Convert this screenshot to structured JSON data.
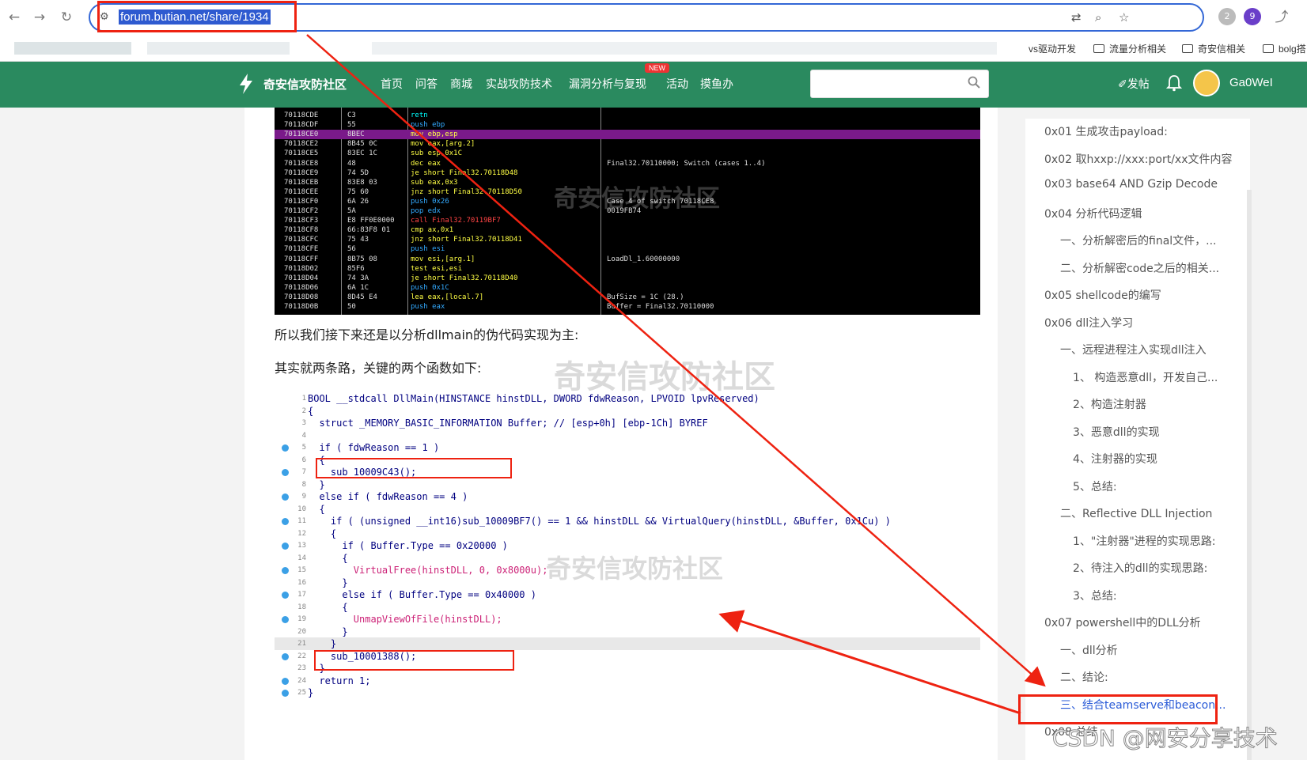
{
  "browser": {
    "url": "forum.butian.net/share/1934",
    "bookmarks": [
      "vs驱动开发",
      "流量分析相关",
      "奇安信相关",
      "bolg搭"
    ],
    "ext_badges": [
      "2",
      "9"
    ]
  },
  "site": {
    "logo": "奇安信攻防社区",
    "nav": [
      "首页",
      "问答",
      "商城",
      "实战攻防技术",
      "漏洞分析与复现",
      "活动",
      "摸鱼办"
    ],
    "new_badge": "NEW",
    "post_label": "✐发帖",
    "username": "Ga0WeI"
  },
  "disasm": {
    "rows": [
      {
        "addr": "70118CDE",
        "bytes": "C3",
        "ins": "retn",
        "comment": ""
      },
      {
        "addr": "70118CDF",
        "bytes": "55",
        "ins": "push ebp",
        "comment": ""
      },
      {
        "addr": "70118CE0",
        "bytes": "8BEC",
        "ins": "mov ebp,esp",
        "comment": ""
      },
      {
        "addr": "70118CE2",
        "bytes": "8B45 0C",
        "ins": "mov eax,[arg.2]",
        "comment": ""
      },
      {
        "addr": "70118CE5",
        "bytes": "83EC 1C",
        "ins": "sub esp,0x1C",
        "comment": ""
      },
      {
        "addr": "70118CE8",
        "bytes": "48",
        "ins": "dec eax",
        "comment": "Final32.70110000; Switch (cases 1..4)"
      },
      {
        "addr": "70118CE9",
        "bytes": "74 5D",
        "ins": "je short Final32.70118D48",
        "comment": ""
      },
      {
        "addr": "70118CEB",
        "bytes": "83E8 03",
        "ins": "sub eax,0x3",
        "comment": ""
      },
      {
        "addr": "70118CEE",
        "bytes": "75 60",
        "ins": "jnz short Final32.70118D50",
        "comment": ""
      },
      {
        "addr": "70118CF0",
        "bytes": "6A 26",
        "ins": "push 0x26",
        "comment": "Case 4 of switch 70118CE8"
      },
      {
        "addr": "70118CF2",
        "bytes": "5A",
        "ins": "pop edx",
        "comment": "0019FB74"
      },
      {
        "addr": "70118CF3",
        "bytes": "E8 FF0E0000",
        "ins": "call Final32.70119BF7",
        "comment": ""
      },
      {
        "addr": "70118CF8",
        "bytes": "66:83F8 01",
        "ins": "cmp ax,0x1",
        "comment": ""
      },
      {
        "addr": "70118CFC",
        "bytes": "75 43",
        "ins": "jnz short Final32.70118D41",
        "comment": ""
      },
      {
        "addr": "70118CFE",
        "bytes": "56",
        "ins": "push esi",
        "comment": ""
      },
      {
        "addr": "70118CFF",
        "bytes": "8B75 08",
        "ins": "mov esi,[arg.1]",
        "comment": "LoadDl_1.60000000"
      },
      {
        "addr": "70118D02",
        "bytes": "85F6",
        "ins": "test esi,esi",
        "comment": ""
      },
      {
        "addr": "70118D04",
        "bytes": "74 3A",
        "ins": "je short Final32.70118D40",
        "comment": ""
      },
      {
        "addr": "70118D06",
        "bytes": "6A 1C",
        "ins": "push 0x1C",
        "comment": ""
      },
      {
        "addr": "70118D08",
        "bytes": "8D45 E4",
        "ins": "lea eax,[local.7]",
        "comment": "BufSize = 1C (28.)"
      },
      {
        "addr": "70118D0B",
        "bytes": "50",
        "ins": "push eax",
        "comment": "Buffer = Final32.70110000"
      }
    ]
  },
  "article": {
    "p1": "所以我们接下来还是以分析dllmain的伪代码实现为主:",
    "p2": "其实就两条路，关键的两个函数如下:",
    "watermark": "奇安信攻防社区"
  },
  "code": {
    "lines": [
      {
        "n": "1",
        "t": "BOOL __stdcall DllMain(HINSTANCE hinstDLL, DWORD fdwReason, LPVOID lpvReserved)",
        "dot": false
      },
      {
        "n": "2",
        "t": "{",
        "dot": false
      },
      {
        "n": "3",
        "t": "  struct _MEMORY_BASIC_INFORMATION Buffer; // [esp+0h] [ebp-1Ch] BYREF",
        "dot": false
      },
      {
        "n": "4",
        "t": "",
        "dot": false
      },
      {
        "n": "5",
        "t": "  if ( fdwReason == 1 )",
        "dot": true
      },
      {
        "n": "6",
        "t": "  {",
        "dot": false
      },
      {
        "n": "7",
        "t": "    sub_10009C43();",
        "dot": true
      },
      {
        "n": "8",
        "t": "  }",
        "dot": false
      },
      {
        "n": "9",
        "t": "  else if ( fdwReason == 4 )",
        "dot": true
      },
      {
        "n": "10",
        "t": "  {",
        "dot": false
      },
      {
        "n": "11",
        "t": "    if ( (unsigned __int16)sub_10009BF7() == 1 && hinstDLL && VirtualQuery(hinstDLL, &Buffer, 0x1Cu) )",
        "dot": true
      },
      {
        "n": "12",
        "t": "    {",
        "dot": false
      },
      {
        "n": "13",
        "t": "      if ( Buffer.Type == 0x20000 )",
        "dot": true
      },
      {
        "n": "14",
        "t": "      {",
        "dot": false
      },
      {
        "n": "15",
        "t": "        VirtualFree(hinstDLL, 0, 0x8000u);",
        "dot": true
      },
      {
        "n": "16",
        "t": "      }",
        "dot": false
      },
      {
        "n": "17",
        "t": "      else if ( Buffer.Type == 0x40000 )",
        "dot": true
      },
      {
        "n": "18",
        "t": "      {",
        "dot": false
      },
      {
        "n": "19",
        "t": "        UnmapViewOfFile(hinstDLL);",
        "dot": true
      },
      {
        "n": "20",
        "t": "      }",
        "dot": false
      },
      {
        "n": "21",
        "t": "    }",
        "dot": false
      },
      {
        "n": "22",
        "t": "    sub_10001388();",
        "dot": true
      },
      {
        "n": "23",
        "t": "  }",
        "dot": false
      },
      {
        "n": "24",
        "t": "  return 1;",
        "dot": true
      },
      {
        "n": "25",
        "t": "}",
        "dot": true
      }
    ]
  },
  "toc": [
    {
      "label": "0x01 生成攻击payload:",
      "indent": 0
    },
    {
      "label": "0x02 取hxxp://xxx:port/xx文件内容",
      "indent": 0
    },
    {
      "label": "0x03 base64 AND Gzip Decode",
      "indent": 0
    },
    {
      "label": "0x04 分析代码逻辑",
      "indent": 0
    },
    {
      "label": "一、分析解密后的final文件，...",
      "indent": 1
    },
    {
      "label": "二、分析解密code之后的相关...",
      "indent": 1
    },
    {
      "label": "0x05 shellcode的编写",
      "indent": 0
    },
    {
      "label": "0x06 dll注入学习",
      "indent": 0
    },
    {
      "label": "一、远程进程注入实现dll注入",
      "indent": 1
    },
    {
      "label": "1、 构造恶意dll，开发自己...",
      "indent": 2
    },
    {
      "label": "2、构造注射器",
      "indent": 2
    },
    {
      "label": "3、恶意dll的实现",
      "indent": 2
    },
    {
      "label": "4、注射器的实现",
      "indent": 2
    },
    {
      "label": "5、总结:",
      "indent": 2
    },
    {
      "label": "二、Reflective DLL Injection",
      "indent": 1
    },
    {
      "label": "1、\"注射器\"进程的实现思路:",
      "indent": 2
    },
    {
      "label": "2、待注入的dll的实现思路:",
      "indent": 2
    },
    {
      "label": "3、总结:",
      "indent": 2
    },
    {
      "label": "0x07 powershell中的DLL分析",
      "indent": 0
    },
    {
      "label": "一、dll分析",
      "indent": 1
    },
    {
      "label": "二、结论:",
      "indent": 1
    },
    {
      "label": "三、结合teamserve和beacon...",
      "indent": 1,
      "active": true
    },
    {
      "label": "0x08 总结",
      "indent": 0
    }
  ],
  "csdn_watermark": "CSDN @网安分享技术"
}
